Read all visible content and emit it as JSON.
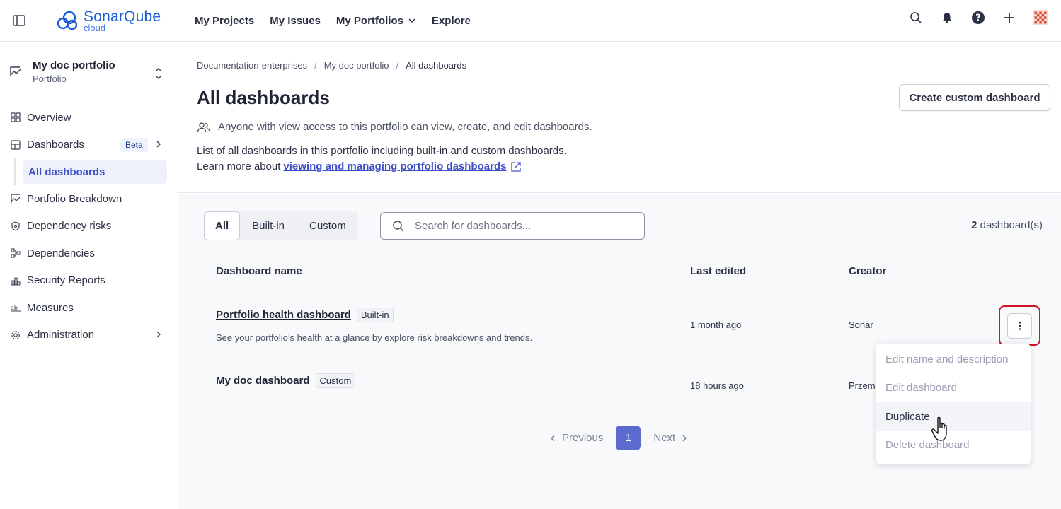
{
  "topbar": {
    "logo_brand": "SonarQube",
    "logo_sub": "cloud",
    "nav": [
      "My Projects",
      "My Issues",
      "My Portfolios",
      "Explore"
    ],
    "icons": [
      "search-icon",
      "bell-icon",
      "help-icon",
      "plus-icon",
      "avatar"
    ]
  },
  "sidebar": {
    "portfolio_name": "My doc portfolio",
    "portfolio_type": "Portfolio",
    "items": [
      {
        "label": "Overview",
        "icon": "grid-icon"
      },
      {
        "label": "Dashboards",
        "icon": "layout-icon",
        "badge": "Beta"
      },
      {
        "label": "All dashboards"
      },
      {
        "label": "Portfolio Breakdown",
        "icon": "breakdown-icon"
      },
      {
        "label": "Dependency risks",
        "icon": "shield-icon"
      },
      {
        "label": "Dependencies",
        "icon": "dependencies-icon"
      },
      {
        "label": "Security Reports",
        "icon": "reports-icon"
      },
      {
        "label": "Measures",
        "icon": "measures-icon"
      },
      {
        "label": "Administration",
        "icon": "gear-icon"
      }
    ]
  },
  "header": {
    "breadcrumb": [
      "Documentation-enterprises",
      "My doc portfolio",
      "All dashboards"
    ],
    "title": "All dashboards",
    "create_button": "Create custom dashboard",
    "access_note": "Anyone with view access to this portfolio can view, create, and edit dashboards.",
    "description": "List of all dashboards in this portfolio including built-in and custom dashboards.",
    "learn_more_prefix": "Learn more about",
    "learn_more_link": "viewing and managing portfolio dashboards"
  },
  "filters": {
    "tabs": [
      "All",
      "Built-in",
      "Custom"
    ],
    "active_tab": "All",
    "search_placeholder": "Search for dashboards...",
    "count_number": "2",
    "count_label": "dashboard(s)"
  },
  "table": {
    "columns": [
      "Dashboard name",
      "Last edited",
      "Creator"
    ],
    "rows": [
      {
        "name": "Portfolio health dashboard",
        "tag": "Built-in",
        "description": "See your portfolio’s health at a glance by explore risk breakdowns and trends.",
        "last_edited": "1 month ago",
        "creator": "Sonar"
      },
      {
        "name": "My doc dashboard",
        "tag": "Custom",
        "description": "",
        "last_edited": "18 hours ago",
        "creator": "Przem"
      }
    ]
  },
  "pagination": {
    "previous": "Previous",
    "page": "1",
    "next": "Next"
  },
  "menu": {
    "items": [
      "Edit name and description",
      "Edit dashboard",
      "Duplicate",
      "Delete dashboard"
    ],
    "enabled_item": "Duplicate"
  },
  "colors": {
    "accent": "#5d6bd1",
    "link": "#3d4fc7",
    "highlight_border": "#d0152a",
    "brand": "#1c5bd6"
  }
}
